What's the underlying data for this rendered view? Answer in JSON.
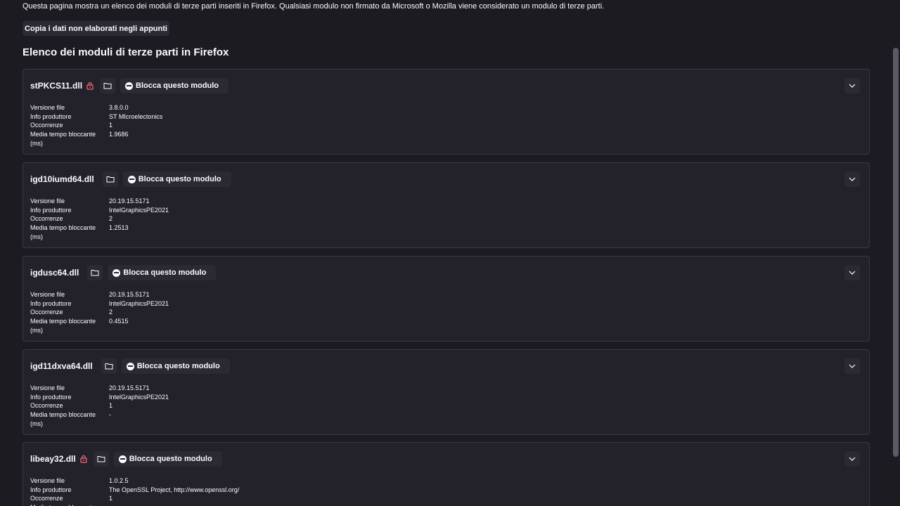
{
  "intro_text": "Questa pagina mostra un elenco dei moduli di terze parti inseriti in Firefox. Qualsiasi modulo non firmato da Microsoft o Mozilla viene considerato un modulo di terze parti.",
  "copy_button_label": "Copia i dati non elaborati negli appunti",
  "section_title": "Elenco dei moduli di terze parti in Firefox",
  "field_labels": {
    "version": "Versione file",
    "vendor": "Info produttore",
    "occurrences": "Occorrenze",
    "blocking_time": "Media tempo bloccante",
    "blocking_time_unit": "(ms)"
  },
  "block_button_label": "Blocca questo modulo",
  "icons": {
    "lock": "lock-icon",
    "folder": "folder-icon",
    "block": "block-icon",
    "expand": "chevron-down-icon"
  },
  "colors": {
    "background": "#1c1b22",
    "card": "#23222b",
    "button": "#2b2a33",
    "lock_red": "#ff6a75"
  },
  "modules": [
    {
      "name": "stPKCS11.dll",
      "locked": true,
      "version": "3.8.0.0",
      "vendor": "ST MIcroelectonics",
      "occurrences": "1",
      "blocking_time": "1.9686"
    },
    {
      "name": "igd10iumd64.dll",
      "locked": false,
      "version": "20.19.15.5171",
      "vendor": "IntelGraphicsPE2021",
      "occurrences": "2",
      "blocking_time": "1.2513"
    },
    {
      "name": "igdusc64.dll",
      "locked": false,
      "version": "20.19.15.5171",
      "vendor": "IntelGraphicsPE2021",
      "occurrences": "2",
      "blocking_time": "0.4515"
    },
    {
      "name": "igd11dxva64.dll",
      "locked": false,
      "version": "20.19.15.5171",
      "vendor": "IntelGraphicsPE2021",
      "occurrences": "1",
      "blocking_time": "-"
    },
    {
      "name": "libeay32.dll",
      "locked": true,
      "version": "1.0.2.5",
      "vendor": "The OpenSSL Project, http://www.openssl.org/",
      "occurrences": "1",
      "blocking_time": ""
    }
  ]
}
